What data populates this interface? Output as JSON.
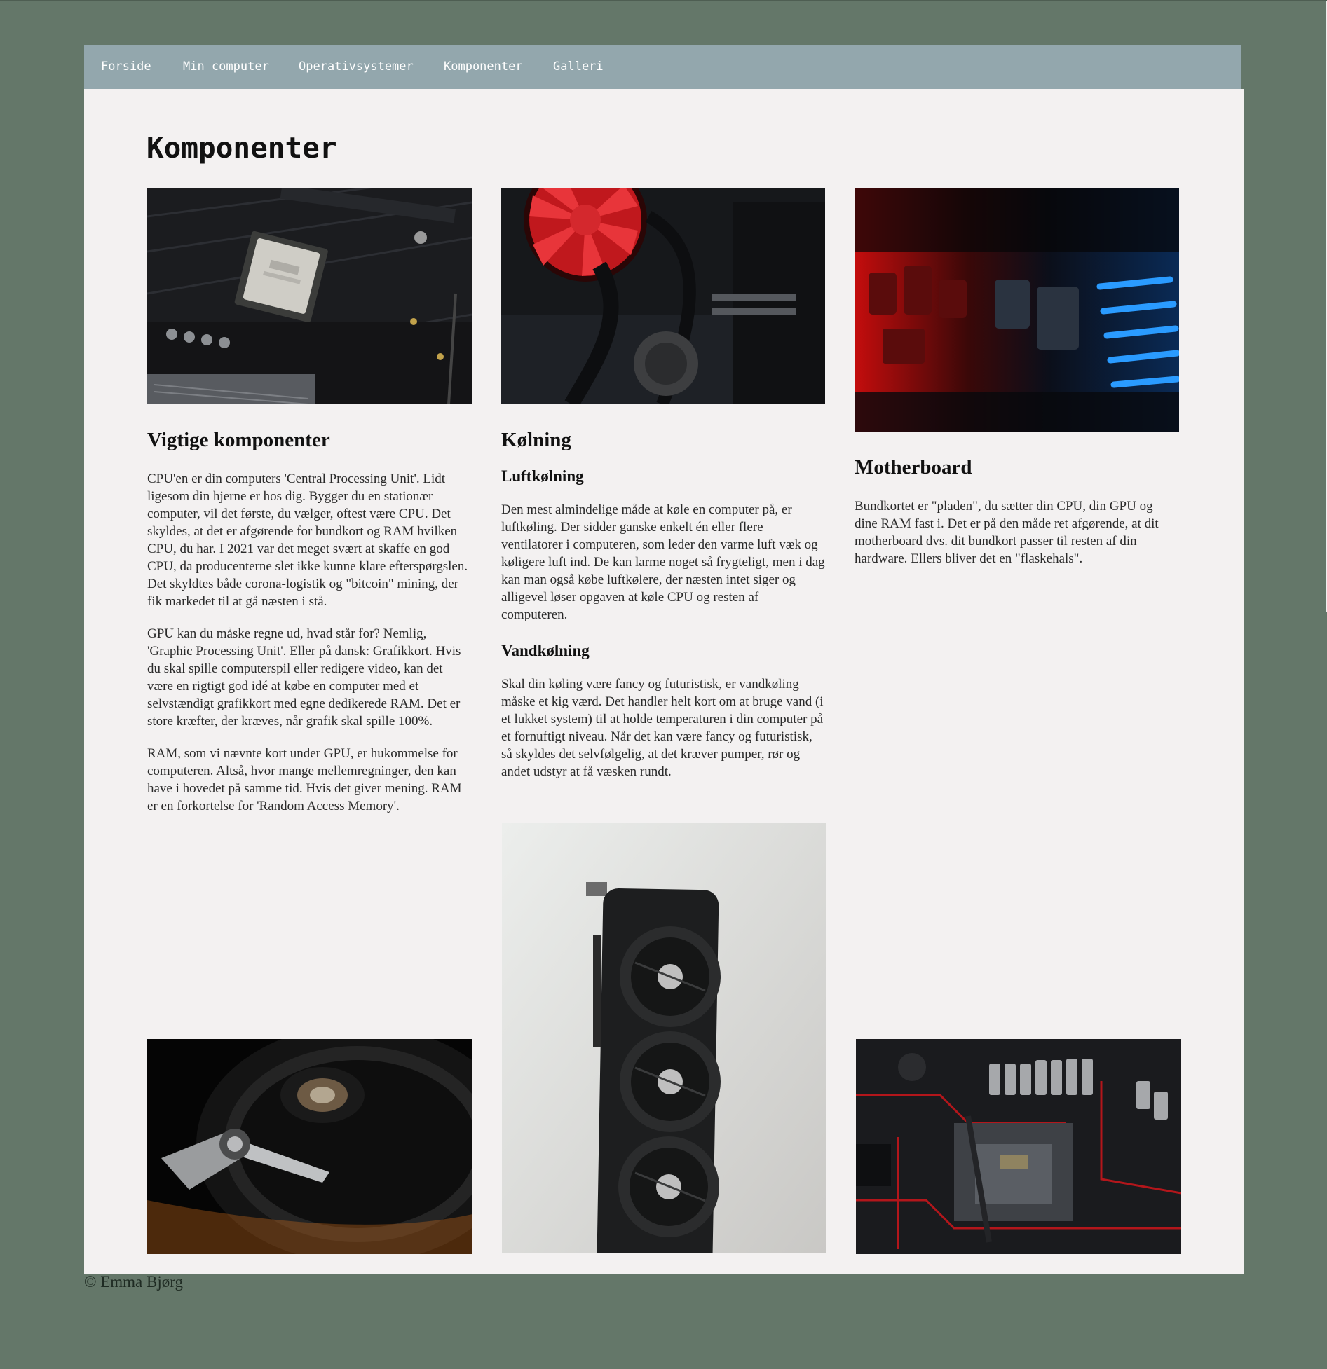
{
  "nav": {
    "items": [
      {
        "label": "Forside"
      },
      {
        "label": "Min computer"
      },
      {
        "label": "Operativsystemer"
      },
      {
        "label": "Komponenter"
      },
      {
        "label": "Galleri"
      }
    ]
  },
  "page": {
    "title": "Komponenter"
  },
  "columns": {
    "vigtige": {
      "heading": "Vigtige komponenter",
      "paragraphs": [
        "CPU'en er din computers 'Central Processing Unit'. Lidt ligesom din hjerne er hos dig. Bygger du en stationær computer, vil det første, du vælger, oftest være CPU. Det skyldes, at det er afgørende for bundkort og RAM hvilken CPU, du har. I 2021 var det meget svært at skaffe en god CPU, da producenterne slet ikke kunne klare efterspørgslen. Det skyldtes både corona-logistik og \"bitcoin\" mining, der fik markedet til at gå næsten i stå.",
        "GPU kan du måske regne ud, hvad står for? Nemlig, 'Graphic Processing Unit'. Eller på dansk: Grafikkort. Hvis du skal spille computerspil eller redigere video, kan det være en rigtigt god idé at købe en computer med et selvstændigt grafikkort med egne dedikerede RAM. Det er store kræfter, der kræves, når grafik skal spille 100%.",
        "RAM, som vi nævnte kort under GPU, er hukommelse for computeren. Altså, hvor mange mellemregninger, den kan have i hovedet på samme tid. Hvis det giver mening. RAM er en forkortelse for 'Random Access Memory'."
      ]
    },
    "kolning": {
      "heading": "Kølning",
      "luft": {
        "heading": "Luftkølning",
        "text": "Den mest almindelige måde at køle en computer på, er luftkøling. Der sidder ganske enkelt én eller flere ventilatorer i computeren, som leder den varme luft væk og køligere luft ind. De kan larme noget så frygteligt, men i dag kan man også købe luftkølere, der næsten intet siger og alligevel løser opgaven at køle CPU og resten af computeren."
      },
      "vand": {
        "heading": "Vandkølning",
        "text": "Skal din køling være fancy og futuristisk, er vandkøling måske et kig værd. Det handler helt kort om at bruge vand (i et lukket system) til at holde temperaturen i din computer på et fornuftigt niveau. Når det kan være fancy og futuristisk, så skyldes det selvfølgelig, at det kræver pumper, rør og andet udstyr at få væsken rundt."
      }
    },
    "motherboard": {
      "heading": "Motherboard",
      "text": "Bundkortet er \"pladen\", du sætter din CPU, din GPU og dine RAM fast i. Det er på den måde ret afgørende, at dit motherboard dvs. dit bundkort passer til resten af din hardware. Ellers bliver det en \"flaskehals\"."
    }
  },
  "footer": {
    "text": "© Emma Bjørg"
  },
  "colors": {
    "background": "#647769",
    "nav_bg": "#93a7ad",
    "content_bg": "#f3f1f1"
  }
}
